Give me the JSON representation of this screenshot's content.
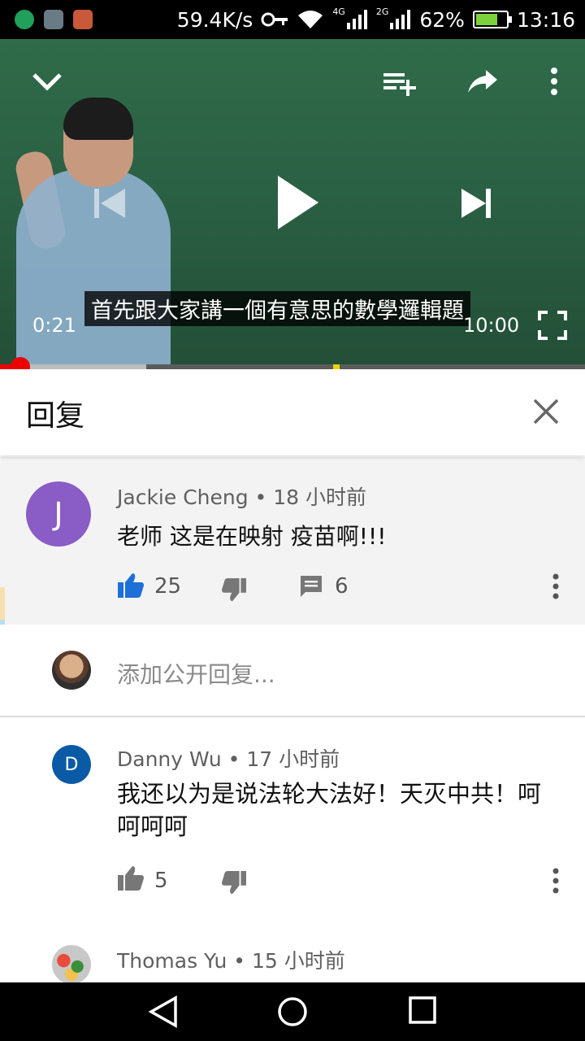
{
  "status_bar": {
    "speed": "59.4K/s",
    "net_4g": "4G",
    "net_2g": "2G",
    "battery": "62%",
    "time": "13:16"
  },
  "video": {
    "caption": "首先跟大家講一個有意思的數學邏輯題",
    "current_time": "0:21",
    "total_time": "10:00",
    "progress_fraction": 0.035
  },
  "reply_panel": {
    "title": "回复"
  },
  "main_comment": {
    "avatar_letter": "J",
    "author": "Jackie Cheng",
    "time": "18 小时前",
    "text": "老师  这是在映射 疫苗啊!!!",
    "likes": "25",
    "replies": "6"
  },
  "add_reply": {
    "placeholder": "添加公开回复..."
  },
  "replies": [
    {
      "avatar_letter": "D",
      "author": "Danny Wu",
      "time": "17 小时前",
      "text": "我还以为是说法轮大法好！天灭中共！呵呵呵呵",
      "likes": "5"
    },
    {
      "author": "Thomas Yu",
      "time": "15 小时前"
    }
  ],
  "colors": {
    "accent_red": "#e00000",
    "like_blue": "#1e6fd8",
    "avatar_purple": "#8a5cc6",
    "avatar_blue": "#0b5aa6"
  },
  "icons": [
    "collapse-chevron-icon",
    "add-to-queue-icon",
    "share-icon",
    "more-vert-icon",
    "previous-icon",
    "play-icon",
    "next-icon",
    "fullscreen-icon",
    "close-icon",
    "thumb-up-icon",
    "thumb-down-icon",
    "comment-icon",
    "back-icon",
    "home-icon",
    "recents-icon"
  ]
}
